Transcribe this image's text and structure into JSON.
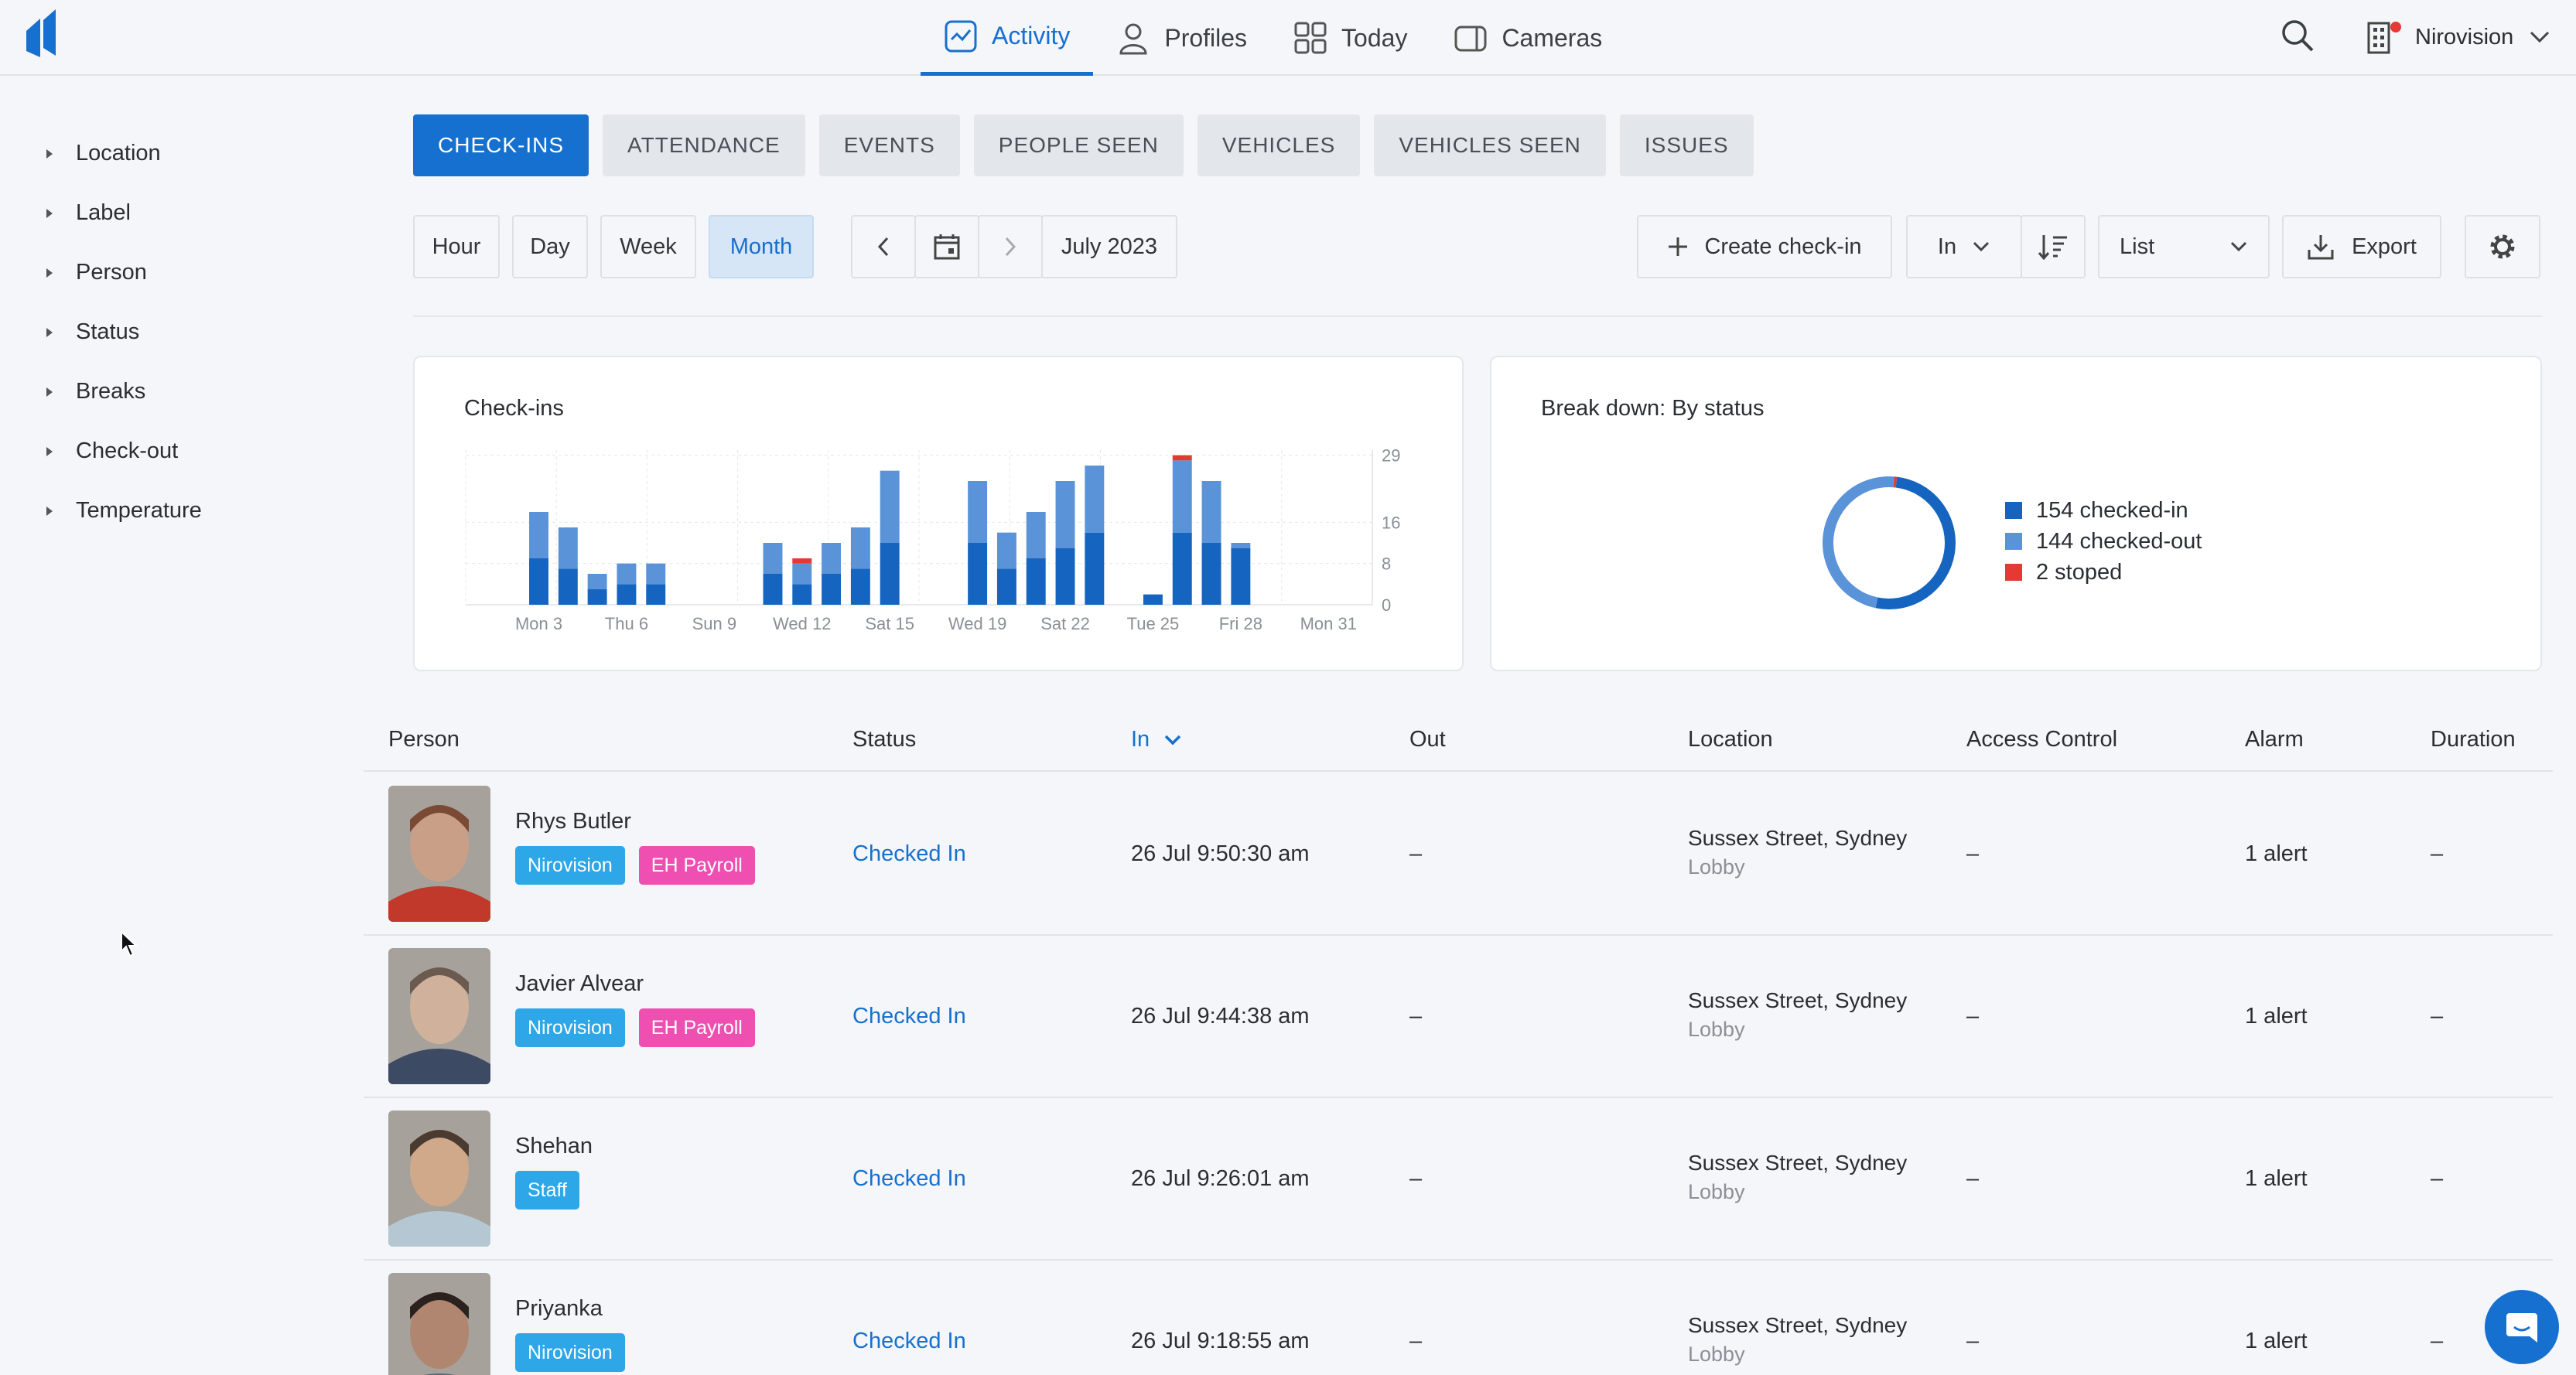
{
  "nav": {
    "items": [
      {
        "label": "Activity",
        "icon": "activity-icon",
        "active": true
      },
      {
        "label": "Profiles",
        "icon": "person-icon"
      },
      {
        "label": "Today",
        "icon": "grid-icon"
      },
      {
        "label": "Cameras",
        "icon": "camera-icon"
      }
    ],
    "org_name": "Nirovision"
  },
  "sidebar": {
    "filters": [
      "Location",
      "Label",
      "Person",
      "Status",
      "Breaks",
      "Check-out",
      "Temperature"
    ]
  },
  "tabs": [
    "CHECK-INS",
    "ATTENDANCE",
    "EVENTS",
    "PEOPLE SEEN",
    "VEHICLES",
    "VEHICLES SEEN",
    "ISSUES"
  ],
  "toolbar": {
    "ranges": [
      "Hour",
      "Day",
      "Week",
      "Month"
    ],
    "selected_range": "Month",
    "period": "July 2023",
    "create_label": "Create check-in",
    "direction": "In",
    "view": "List",
    "export_label": "Export"
  },
  "colors": {
    "accent": "#1670cf",
    "checked_in": "#1565c0",
    "checked_out": "#5b93d8",
    "stopped": "#e53935"
  },
  "chart_data": [
    {
      "type": "bar",
      "title": "Check-ins",
      "x_tick_labels": [
        "Mon 3",
        "Thu 6",
        "Sun 9",
        "Wed 12",
        "Sat 15",
        "Wed 19",
        "Sat 22",
        "Tue 25",
        "Fri 28",
        "Mon 31"
      ],
      "y_tick_labels": [
        "0",
        "8",
        "16",
        "29"
      ],
      "ylim": [
        0,
        30
      ],
      "stacked": true,
      "categories": [
        "1",
        "2",
        "3",
        "4",
        "5",
        "6",
        "7",
        "8",
        "9",
        "10",
        "11",
        "12",
        "13",
        "14",
        "15",
        "16",
        "17",
        "18",
        "19",
        "20",
        "21",
        "22",
        "23",
        "24",
        "25",
        "26",
        "27",
        "28",
        "29",
        "30",
        "31"
      ],
      "series": [
        {
          "name": "checked-in",
          "values": [
            0,
            0,
            9,
            7,
            3,
            4,
            4,
            0,
            0,
            0,
            6,
            4,
            6,
            7,
            12,
            0,
            0,
            12,
            7,
            9,
            11,
            14,
            0,
            2,
            14,
            12,
            11,
            0,
            0,
            0,
            0
          ]
        },
        {
          "name": "checked-out",
          "values": [
            0,
            0,
            9,
            8,
            3,
            4,
            4,
            0,
            0,
            0,
            6,
            4,
            6,
            8,
            14,
            0,
            0,
            12,
            7,
            9,
            13,
            13,
            0,
            0,
            14,
            12,
            1,
            0,
            0,
            0,
            0
          ]
        },
        {
          "name": "stoped",
          "values": [
            0,
            0,
            0,
            0,
            0,
            0,
            0,
            0,
            0,
            0,
            0,
            1,
            0,
            0,
            0,
            0,
            0,
            0,
            0,
            0,
            0,
            0,
            0,
            0,
            1,
            0,
            0,
            0,
            0,
            0,
            0
          ]
        }
      ]
    },
    {
      "type": "pie",
      "title": "Break down: By status",
      "labels": [
        "154 checked-in",
        "144 checked-out",
        "2 stoped"
      ],
      "values": [
        154,
        144,
        2
      ]
    }
  ],
  "table": {
    "headers": {
      "person": "Person",
      "status": "Status",
      "in": "In",
      "out": "Out",
      "location": "Location",
      "access": "Access Control",
      "alarm": "Alarm",
      "duration": "Duration"
    },
    "rows": [
      {
        "name": "Rhys Butler",
        "labels": [
          {
            "text": "Nirovision",
            "color": "#2ea7e8"
          },
          {
            "text": "EH Payroll",
            "color": "#ee4fb0"
          }
        ],
        "status": "Checked In",
        "in": "26 Jul 9:50:30 am",
        "out": "–",
        "location": "Sussex Street, Sydney",
        "sublocation": "Lobby",
        "access": "–",
        "alarm": "1 alert",
        "duration": "–"
      },
      {
        "name": "Javier Alvear",
        "labels": [
          {
            "text": "Nirovision",
            "color": "#2ea7e8"
          },
          {
            "text": "EH Payroll",
            "color": "#ee4fb0"
          }
        ],
        "status": "Checked In",
        "in": "26 Jul 9:44:38 am",
        "out": "–",
        "location": "Sussex Street, Sydney",
        "sublocation": "Lobby",
        "access": "–",
        "alarm": "1 alert",
        "duration": "–"
      },
      {
        "name": "Shehan",
        "labels": [
          {
            "text": "Staff",
            "color": "#2ea7e8"
          }
        ],
        "status": "Checked In",
        "in": "26 Jul 9:26:01 am",
        "out": "–",
        "location": "Sussex Street, Sydney",
        "sublocation": "Lobby",
        "access": "–",
        "alarm": "1 alert",
        "duration": "–"
      },
      {
        "name": "Priyanka",
        "labels": [
          {
            "text": "Nirovision",
            "color": "#2ea7e8"
          }
        ],
        "status": "Checked In",
        "in": "26 Jul 9:18:55 am",
        "out": "–",
        "location": "Sussex Street, Sydney",
        "sublocation": "Lobby",
        "access": "–",
        "alarm": "1 alert",
        "duration": "–"
      }
    ]
  }
}
